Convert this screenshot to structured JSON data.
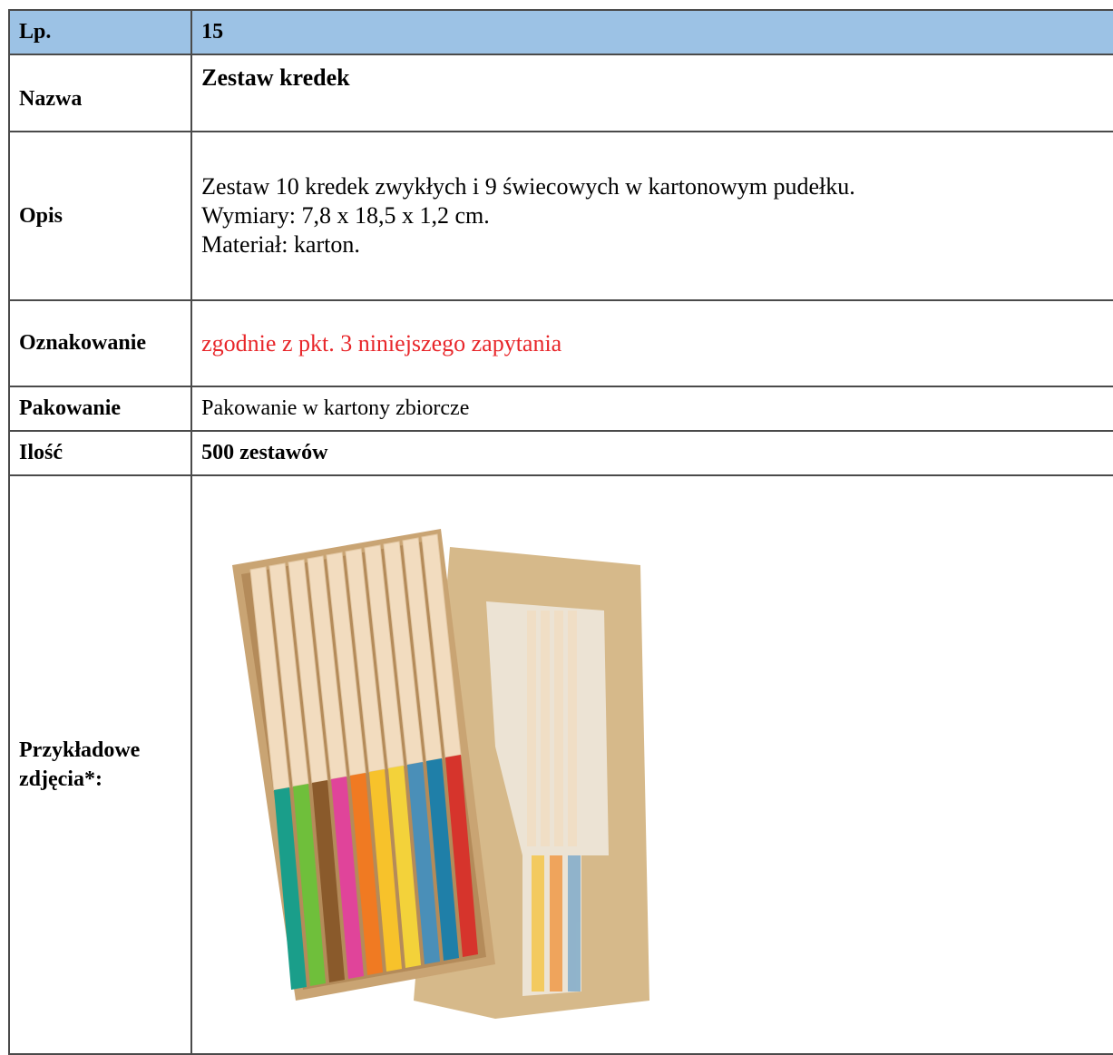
{
  "rows": {
    "lp": {
      "label": "Lp.",
      "value": "15"
    },
    "nazwa": {
      "label": "Nazwa",
      "value": "Zestaw kredek"
    },
    "opis": {
      "label": "Opis",
      "lines": [
        "Zestaw 10 kredek zwykłych i 9 świecowych w kartonowym pudełku.",
        "Wymiary: 7,8 x 18,5 x 1,2 cm.",
        "Materiał: karton."
      ]
    },
    "oznakowanie": {
      "label": "Oznakowanie",
      "value": "zgodnie z pkt. 3 niniejszego zapytania"
    },
    "pakowanie": {
      "label": "Pakowanie",
      "value": "Pakowanie w kartony zbiorcze"
    },
    "ilosc": {
      "label": "Ilość",
      "value": "500 zestawów"
    },
    "zdjecia": {
      "label_line1": "Przykładowe",
      "label_line2": "zdjęcia*:"
    }
  },
  "colors": {
    "header_bg": "#9cc2e5",
    "highlight_text": "#e8262a",
    "border": "#4a4a4a"
  },
  "photo": {
    "subject": "crayon-and-pencil-set-in-cardboard-box"
  }
}
